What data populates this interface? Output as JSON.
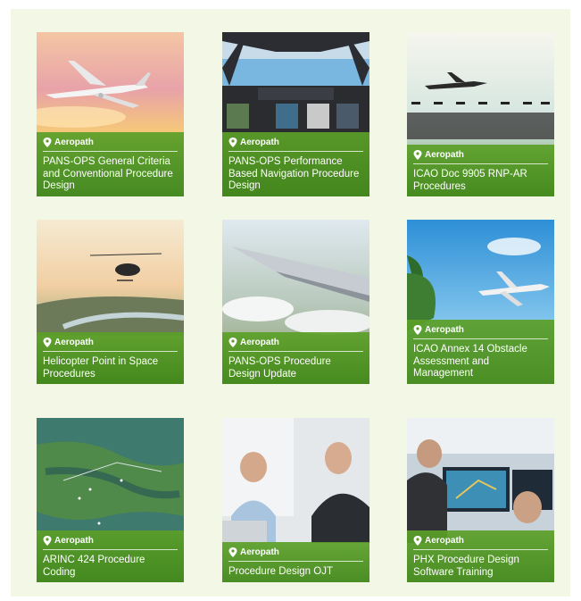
{
  "brand_name": "Aeropath",
  "colors": {
    "panel_bg": "#f2f7e6",
    "band_green": "#5aa028"
  },
  "courses": [
    {
      "title": "PANS-OPS General Criteria and Conventional Procedure Design",
      "image": "airliner-sunset"
    },
    {
      "title": "PANS-OPS Performance Based Navigation Procedure Design",
      "image": "cockpit"
    },
    {
      "title": "ICAO Doc 9905 RNP-AR Procedures",
      "image": "airliner-approach-lights"
    },
    {
      "title": "Helicopter Point in Space Procedures",
      "image": "helicopter-river"
    },
    {
      "title": "PANS-OPS Procedure Design Update",
      "image": "wing-clouds"
    },
    {
      "title": "ICAO Annex 14 Obstacle Assessment and Management",
      "image": "airliner-palms"
    },
    {
      "title": "ARINC 424 Procedure Coding",
      "image": "terrain-map"
    },
    {
      "title": "Procedure Design OJT",
      "image": "two-men-meeting"
    },
    {
      "title": "PHX Procedure Design Software Training",
      "image": "software-screens"
    }
  ]
}
